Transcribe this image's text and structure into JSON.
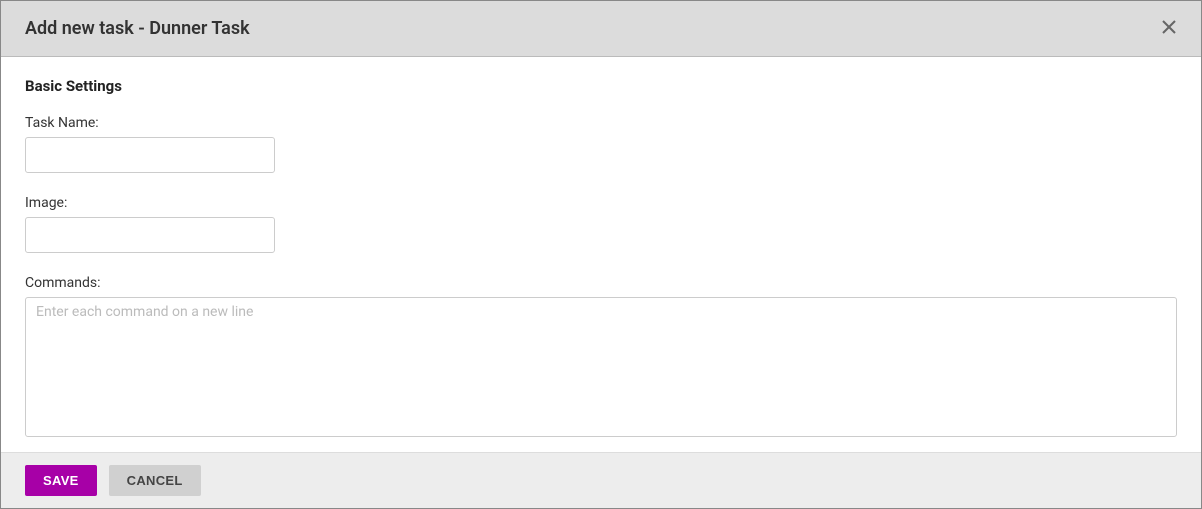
{
  "modal": {
    "title": "Add new task - Dunner Task"
  },
  "section": {
    "title": "Basic Settings"
  },
  "fields": {
    "taskName": {
      "label": "Task Name:",
      "value": ""
    },
    "image": {
      "label": "Image:",
      "value": ""
    },
    "commands": {
      "label": "Commands:",
      "value": "",
      "placeholder": "Enter each command on a new line"
    }
  },
  "buttons": {
    "save": "SAVE",
    "cancel": "CANCEL"
  }
}
